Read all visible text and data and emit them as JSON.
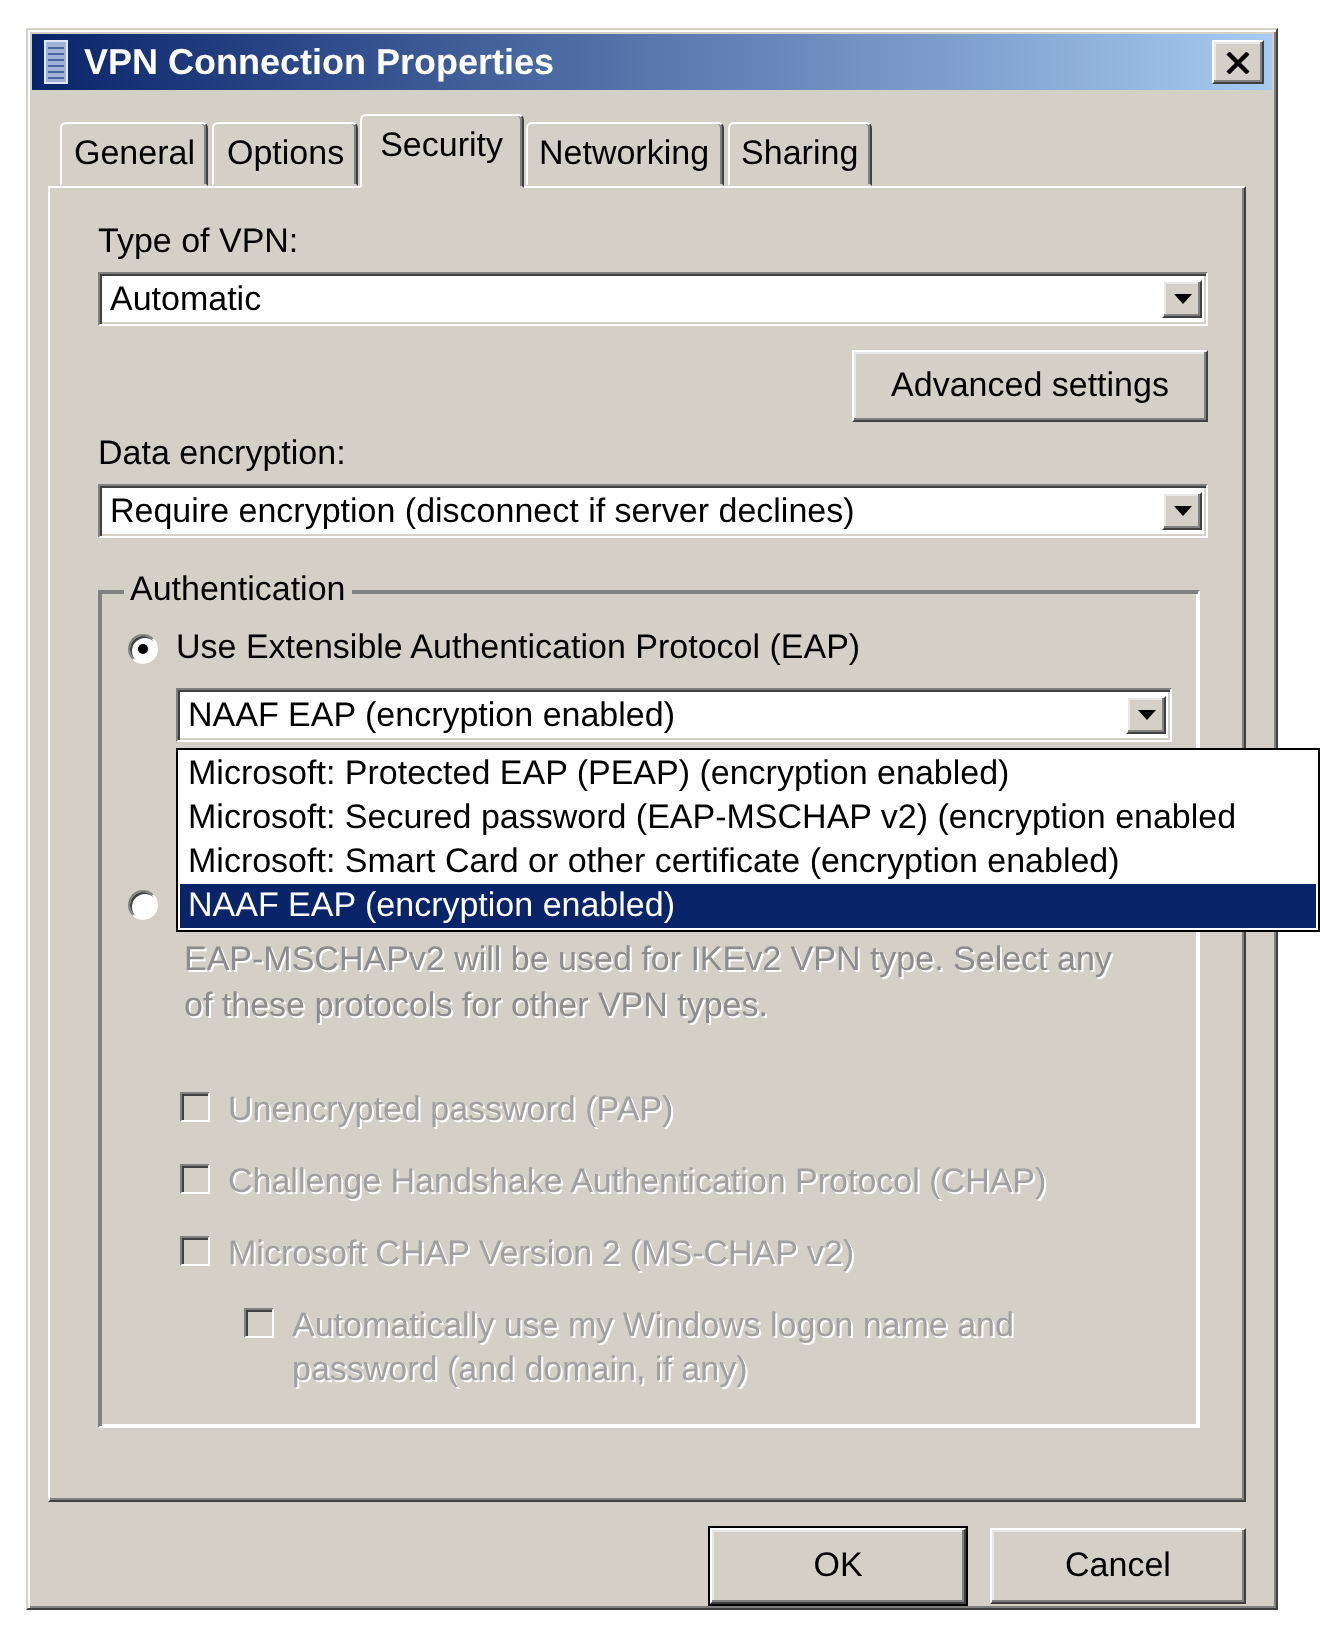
{
  "window": {
    "title": "VPN Connection Properties"
  },
  "tabs": [
    {
      "label": "General",
      "selected": false
    },
    {
      "label": "Options",
      "selected": false
    },
    {
      "label": "Security",
      "selected": true
    },
    {
      "label": "Networking",
      "selected": false
    },
    {
      "label": "Sharing",
      "selected": false
    }
  ],
  "type_of_vpn": {
    "label": "Type of VPN:",
    "value": "Automatic"
  },
  "advanced_button": "Advanced settings",
  "data_encryption": {
    "label": "Data encryption:",
    "value": "Require encryption (disconnect if server declines)"
  },
  "authentication": {
    "title": "Authentication",
    "options": [
      {
        "label": "Use Extensible Authentication Protocol (EAP)",
        "selected": true
      },
      {
        "selected": false
      }
    ],
    "eap_method": {
      "value": "NAAF EAP (encryption enabled)",
      "expanded": true,
      "options": [
        {
          "label": "Microsoft: Protected EAP (PEAP) (encryption enabled)",
          "selected": false
        },
        {
          "label": "Microsoft: Secured password (EAP-MSCHAP v2) (encryption enabled",
          "selected": false
        },
        {
          "label": "Microsoft: Smart Card or other certificate (encryption enabled)",
          "selected": false
        },
        {
          "label": "NAAF EAP (encryption enabled)",
          "selected": true
        }
      ]
    },
    "note": "EAP-MSCHAPv2 will be used for IKEv2 VPN type. Select any of these protocols for other VPN types.",
    "protocols": [
      {
        "label": "Unencrypted password (PAP)",
        "checked": false,
        "disabled": true
      },
      {
        "label": "Challenge Handshake Authentication Protocol (CHAP)",
        "checked": false,
        "disabled": true
      },
      {
        "label": "Microsoft CHAP Version 2 (MS-CHAP v2)",
        "checked": false,
        "disabled": true,
        "children": [
          {
            "label": "Automatically use my Windows logon name and password (and domain, if any)",
            "checked": false,
            "disabled": true
          }
        ]
      }
    ]
  },
  "buttons": [
    {
      "label": "OK",
      "default": true
    },
    {
      "label": "Cancel",
      "default": false
    }
  ]
}
